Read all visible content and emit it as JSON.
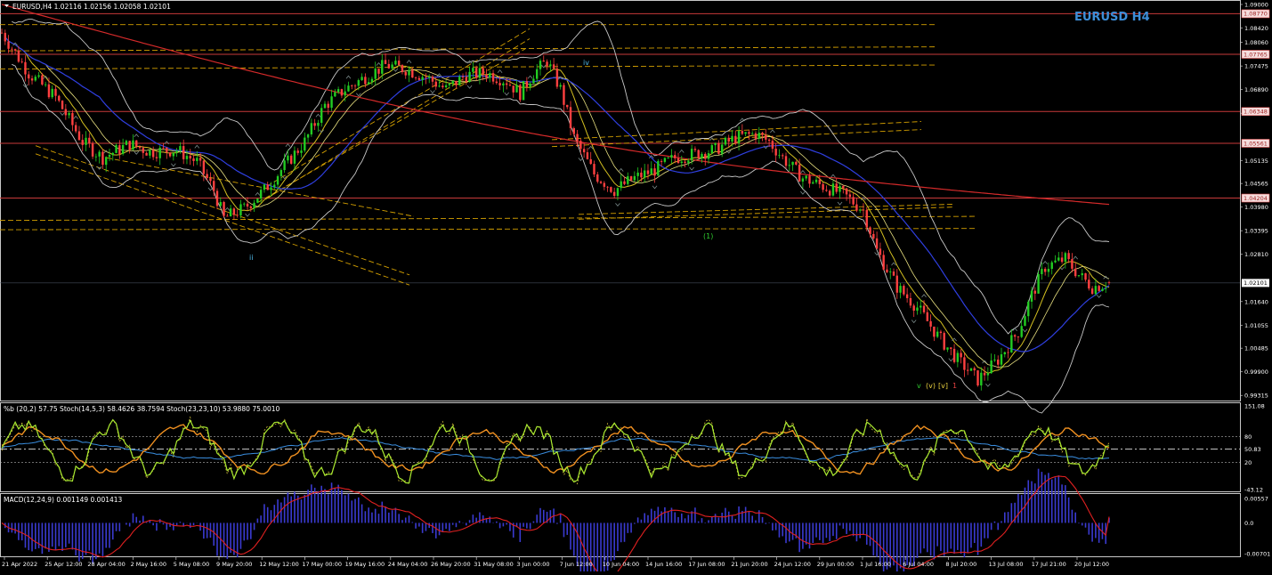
{
  "window": {
    "header": "EURUSD,H4  1.02116 1.02156 1.02058 1.02101",
    "brand": "EURUSD H4",
    "current_price": "1.02101"
  },
  "colors": {
    "background": "#000000",
    "bull": "#22cc22",
    "bear": "#ff4040",
    "ma_long": "#d42a2a",
    "ma_mid": "#2f3fe0",
    "ma_fast": "#d4c020",
    "bollinger": "#c8c8c8",
    "level_line": "#c83a3a",
    "fib_dashed": "#d4a000",
    "stoch_main": "#a8e830",
    "stoch_slow": "#f09020",
    "stoch_long": "#3a8ee0",
    "macd_hist": "#3a3ad0",
    "macd_signal": "#e02020",
    "brand": "#3d8ed8"
  },
  "chart_data": [
    {
      "type": "candlestick",
      "title": "EURUSD,H4",
      "symbol": "EURUSD",
      "timeframe": "H4",
      "ohlc_last": {
        "open": 1.02116,
        "high": 1.02156,
        "low": 1.02058,
        "close": 1.02101
      },
      "ylim": [
        0.9921,
        1.09
      ],
      "y_ticks": [
        "1.09000",
        "1.08420",
        "1.08060",
        "1.07475",
        "1.06890",
        "1.06305",
        "1.05135",
        "1.04565",
        "1.03980",
        "1.03395",
        "1.02810",
        "1.01640",
        "1.01055",
        "1.00485",
        "0.99900",
        "0.99315"
      ],
      "horizontal_levels": [
        "1.08770",
        "1.07765",
        "1.06348",
        "1.05561",
        "1.04204"
      ],
      "x_ticks": [
        "21 Apr 2022",
        "25 Apr 12:00",
        "28 Apr 04:00",
        "2 May 16:00",
        "5 May 08:00",
        "9 May 20:00",
        "12 May 12:00",
        "17 May 00:00",
        "19 May 16:00",
        "24 May 04:00",
        "26 May 20:00",
        "31 May 08:00",
        "3 Jun 00:00",
        "7 Jun 12:00",
        "10 Jun 04:00",
        "14 Jun 16:00",
        "17 Jun 08:00",
        "21 Jun 20:00",
        "24 Jun 12:00",
        "29 Jun 00:00",
        "1 Jul 16:00",
        "6 Jul 04:00",
        "8 Jul 20:00",
        "13 Jul 08:00",
        "17 Jul 21:00",
        "20 Jul 12:00"
      ],
      "close_path": [
        [
          0,
          1.083
        ],
        [
          8,
          1.073
        ],
        [
          16,
          1.067
        ],
        [
          24,
          1.056
        ],
        [
          30,
          1.052
        ],
        [
          38,
          1.0555
        ],
        [
          44,
          1.0535
        ],
        [
          52,
          1.054
        ],
        [
          58,
          1.051
        ],
        [
          63,
          1.044
        ],
        [
          66,
          1.037
        ],
        [
          72,
          1.0395
        ],
        [
          78,
          1.044
        ],
        [
          84,
          1.05
        ],
        [
          90,
          1.056
        ],
        [
          96,
          1.065
        ],
        [
          102,
          1.069
        ],
        [
          108,
          1.072
        ],
        [
          114,
          1.075
        ],
        [
          120,
          1.074
        ],
        [
          126,
          1.072
        ],
        [
          132,
          1.069
        ],
        [
          138,
          1.0725
        ],
        [
          144,
          1.073
        ],
        [
          150,
          1.071
        ],
        [
          154,
          1.068
        ],
        [
          158,
          1.073
        ],
        [
          162,
          1.076
        ],
        [
          166,
          1.069
        ],
        [
          170,
          1.057
        ],
        [
          176,
          1.048
        ],
        [
          182,
          1.044
        ],
        [
          188,
          1.047
        ],
        [
          194,
          1.049
        ],
        [
          200,
          1.052
        ],
        [
          206,
          1.053
        ],
        [
          212,
          1.054
        ],
        [
          218,
          1.057
        ],
        [
          224,
          1.058
        ],
        [
          228,
          1.056
        ],
        [
          232,
          1.052
        ],
        [
          238,
          1.047
        ],
        [
          244,
          1.045
        ],
        [
          250,
          1.043
        ],
        [
          256,
          1.039
        ],
        [
          260,
          1.029
        ],
        [
          266,
          1.02
        ],
        [
          272,
          1.015
        ],
        [
          278,
          1.008
        ],
        [
          284,
          1.002
        ],
        [
          290,
          0.997
        ],
        [
          296,
          1.002
        ],
        [
          302,
          1.009
        ],
        [
          306,
          1.018
        ],
        [
          310,
          1.025
        ],
        [
          316,
          1.027
        ],
        [
          320,
          1.023
        ],
        [
          324,
          1.02
        ],
        [
          329,
          1.021
        ]
      ],
      "annotations": [
        "iv",
        "ii",
        "v",
        "(v)",
        "[v]",
        "1",
        "(1)"
      ]
    },
    {
      "type": "line",
      "title": "%b (20,2) 57.75  Stoch(14,5,3) 58.4626 38.7594  Stoch(23,23,10) 53.9880 75.0010",
      "ylim": [
        -43.12,
        151.08
      ],
      "y_ticks": [
        "151.08",
        "80",
        "50.83",
        "20",
        "-43.12"
      ],
      "series": [
        {
          "name": "%b (20,2)",
          "last": 57.75
        },
        {
          "name": "Stoch(14,5,3)",
          "last": [
            58.4626,
            38.7594
          ]
        },
        {
          "name": "Stoch(23,23,10)",
          "last": [
            53.988,
            75.001
          ]
        }
      ]
    },
    {
      "type": "bar",
      "title": "MACD(12,24,9) 0.001149 0.001413",
      "ylim": [
        -0.00701,
        0.00557
      ],
      "y_ticks": [
        "0.00557",
        "0.0",
        "-0.00701"
      ],
      "series": [
        {
          "name": "MACD(12,24,9)",
          "last": 0.001149
        },
        {
          "name": "signal",
          "last": 0.001413
        }
      ]
    }
  ]
}
